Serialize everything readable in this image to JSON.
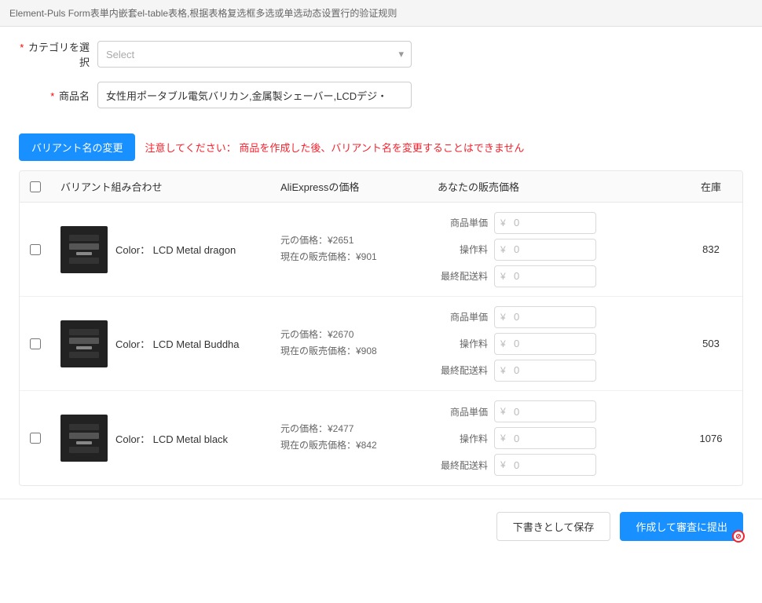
{
  "page": {
    "title": "Element-Puls Form表単内嵌套el-table表格,根据表格复选框多选或单选动态设置行的验证规则"
  },
  "form": {
    "category_label": "カテゴリを選択",
    "category_placeholder": "Select",
    "product_name_label": "商品名",
    "product_name_value": "女性用ポータブル電気バリカン,金属製シェーバー,LCDデジ・"
  },
  "variant_section": {
    "change_button_label": "バリアント名の変更",
    "warning_prefix": "注意してください：",
    "warning_text": "商品を作成した後、バリアント名を変更することはできません"
  },
  "table": {
    "headers": {
      "checkbox": "",
      "variant_combo": "バリアント組み合わせ",
      "aliexpress_price": "AliExpressの価格",
      "your_price": "あなたの販売価格",
      "stock": "在庫"
    },
    "price_labels": {
      "unit_price": "商品単価",
      "handling_fee": "操作料",
      "shipping": "最終配送料"
    },
    "rows": [
      {
        "id": "row1",
        "color": "Color：  LCD Metal dragon",
        "original_price_label": "元の価格：¥2651",
        "current_price_label": "現在の販売価格：¥901",
        "unit_price": "0",
        "handling_fee": "0",
        "shipping": "0",
        "stock": "832"
      },
      {
        "id": "row2",
        "color": "Color：  LCD Metal Buddha",
        "original_price_label": "元の価格：¥2670",
        "current_price_label": "現在の販売価格：¥908",
        "unit_price": "0",
        "handling_fee": "0",
        "shipping": "0",
        "stock": "503"
      },
      {
        "id": "row3",
        "color": "Color：  LCD Metal black",
        "original_price_label": "元の価格：¥2477",
        "current_price_label": "現在の販売価格：¥842",
        "unit_price": "0",
        "handling_fee": "0",
        "shipping": "0",
        "stock": "1076"
      }
    ]
  },
  "footer": {
    "save_draft_label": "下書きとして保存",
    "submit_label": "作成して審査に提出"
  },
  "icons": {
    "chevron_down": "▾",
    "yen_prefix": "¥"
  }
}
